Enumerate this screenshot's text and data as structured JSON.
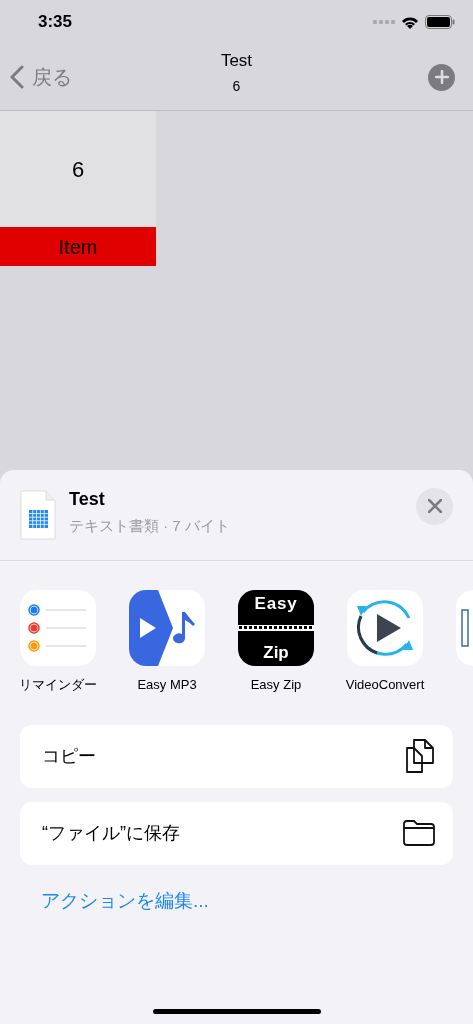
{
  "status_bar": {
    "time": "3:35"
  },
  "nav": {
    "back": "戻る",
    "title": "Test",
    "subtitle": "6"
  },
  "grid": [
    {
      "value": "6",
      "label": "Item"
    }
  ],
  "share_sheet": {
    "file_name": "Test",
    "file_info": "テキスト書類 · 7 バイト",
    "apps": [
      {
        "kind": "reminders",
        "label": "リマインダー"
      },
      {
        "kind": "mp3",
        "label": "Easy MP3"
      },
      {
        "kind": "zip",
        "label": "Easy Zip",
        "icon_top": "Easy",
        "icon_bottom": "Zip"
      },
      {
        "kind": "video",
        "label": "VideoConvert"
      },
      {
        "kind": "partial"
      }
    ],
    "actions": [
      {
        "kind": "copy",
        "label": "コピー"
      },
      {
        "kind": "folder",
        "label": "“ファイル”に保存"
      }
    ],
    "edit_link": "アクションを編集..."
  }
}
